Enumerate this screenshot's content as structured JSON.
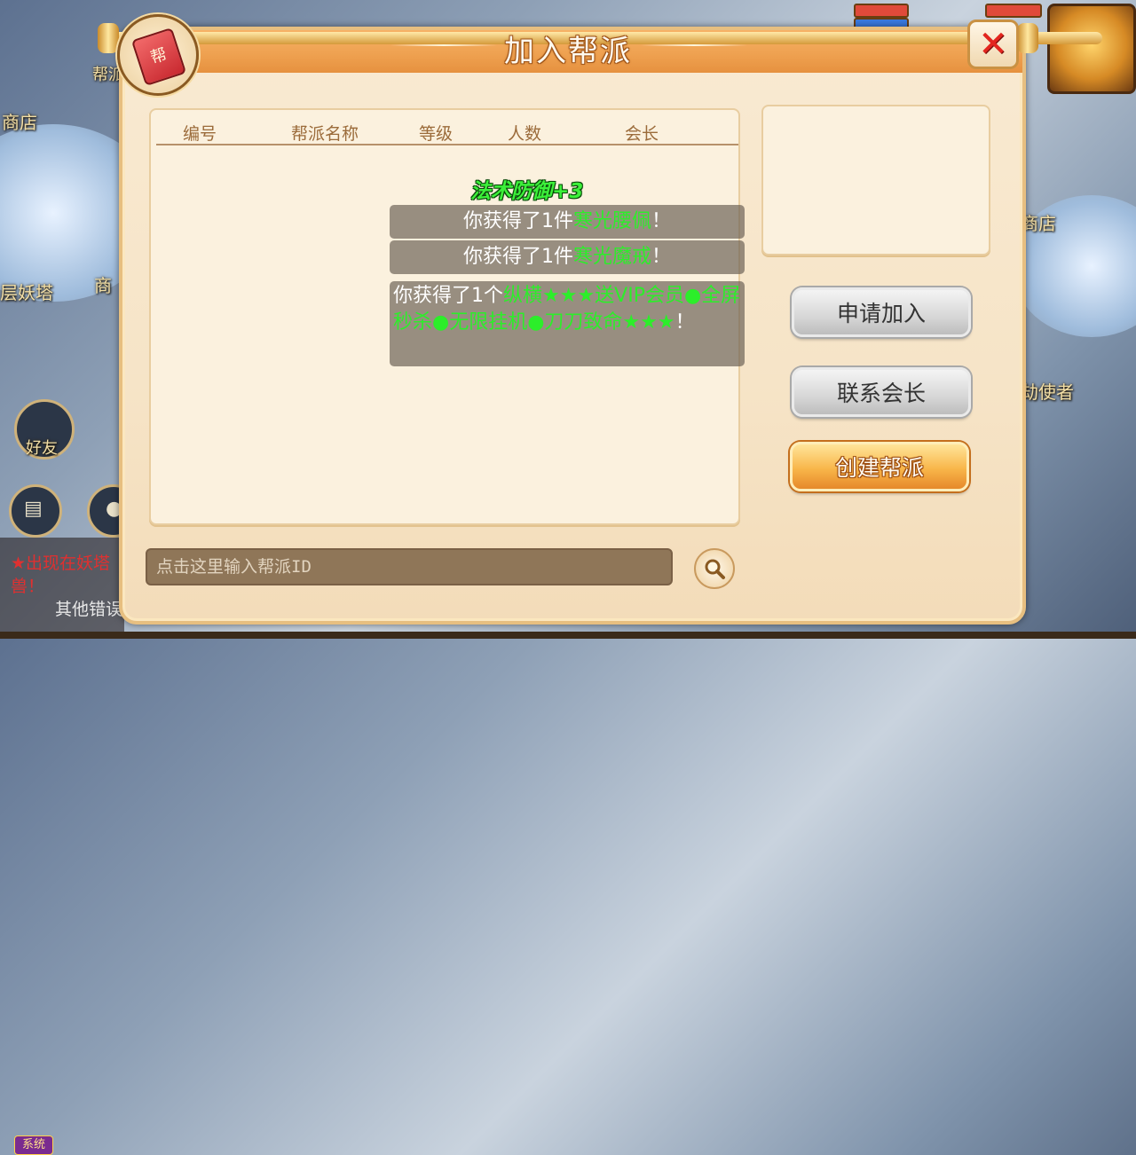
{
  "dialog": {
    "title": "加入帮派",
    "emblem_char": "帮",
    "close_symbol": "✕"
  },
  "table": {
    "headers": [
      "编号",
      "帮派名称",
      "等级",
      "人数",
      "会长"
    ],
    "rows": []
  },
  "buttons": {
    "apply": "申请加入",
    "contact": "联系会长",
    "create": "创建帮派"
  },
  "search": {
    "placeholder": "点击这里输入帮派ID",
    "value": ""
  },
  "notifications": {
    "float_text": "法术防御+3",
    "toasts": [
      {
        "prefix": "你获得了1件",
        "item": "寒光腰佩",
        "suffix": "！"
      },
      {
        "prefix": "你获得了1件",
        "item": "寒光魔戒",
        "suffix": "！"
      },
      {
        "prefix": "你获得了1个",
        "item": "纵横★★★送VIP会员●全屏秒杀●无限挂机●刀刀致命★★★",
        "suffix": "！"
      }
    ]
  },
  "background": {
    "labels": {
      "shop_left": "商店",
      "shop_right": "商店",
      "tower": "层妖塔",
      "envoy": "劫使者",
      "friends": "好友",
      "gang": "帮派",
      "shop_partial": "商"
    },
    "chat": {
      "line1": "★出现在妖塔",
      "line2": "兽！",
      "system_badge": "系统",
      "line3": "其他错误"
    }
  },
  "colors": {
    "accent_gold": "#f8b64a",
    "header_orange": "#eea04f",
    "close_red": "#e3261f",
    "reward_green": "#2cee2a"
  }
}
